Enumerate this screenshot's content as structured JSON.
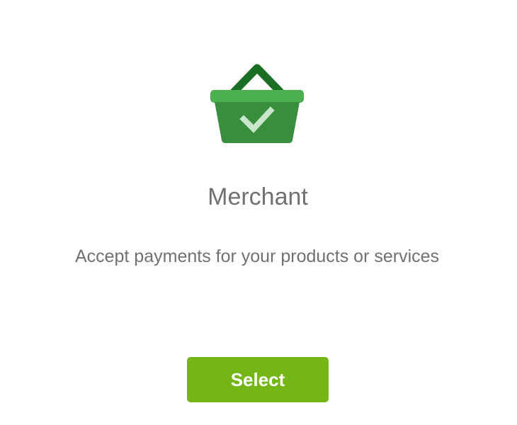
{
  "icon": {
    "name": "shopping-basket-check-icon",
    "colors": {
      "handle": "#1b6f25",
      "rim": "#4caf50",
      "body": "#388e3c",
      "check": "#c8e6c9"
    }
  },
  "card": {
    "title": "Merchant",
    "description": "Accept payments for your products or services",
    "select_label": "Select"
  },
  "colors": {
    "text": "#707070",
    "button": "#74b616",
    "button_text": "#ffffff"
  }
}
